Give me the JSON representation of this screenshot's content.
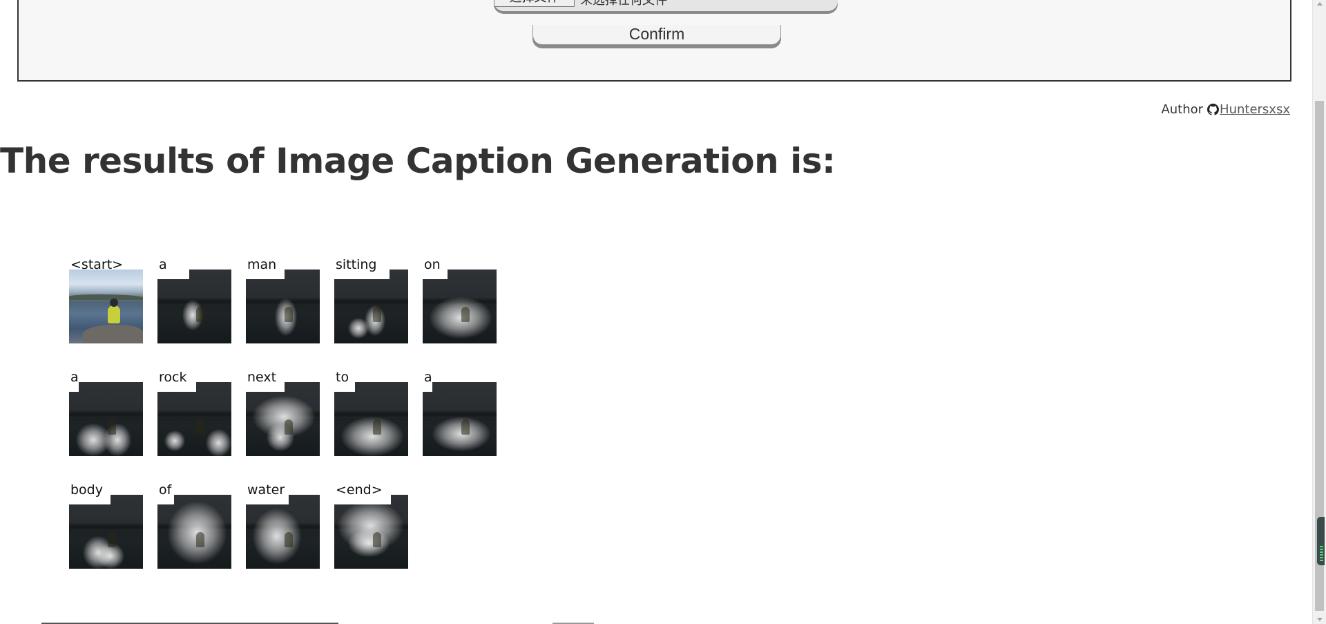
{
  "upload": {
    "choose_file_label": "选择文件",
    "file_status": "未选择任何文件",
    "confirm_label": "Confirm"
  },
  "author": {
    "label": "Author",
    "icon": "github-icon",
    "link_text": "Huntersxsx"
  },
  "heading": "The results of Image Caption Generation is:",
  "attention": {
    "words": [
      "<start>",
      "a",
      "man",
      "sitting",
      "on",
      "a",
      "rock",
      "next",
      "to",
      "a",
      "body",
      "of",
      "water",
      "<end>"
    ]
  },
  "colors": {
    "text": "#333333",
    "panel_bg": "#f7f7f7",
    "panel_border": "#333333",
    "button_shadow": "#8a8a8a"
  }
}
